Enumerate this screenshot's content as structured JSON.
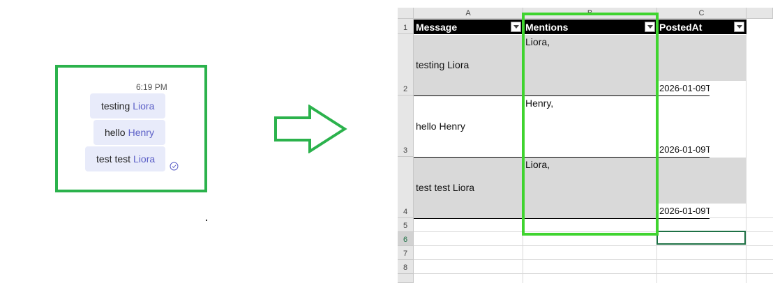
{
  "chat": {
    "time": "6:19 PM",
    "messages": [
      {
        "text": "testing",
        "mention": "Liora"
      },
      {
        "text": "hello",
        "mention": "Henry"
      },
      {
        "text": "test test",
        "mention": "Liora"
      }
    ]
  },
  "sheet": {
    "columns": [
      "A",
      "B",
      "C"
    ],
    "row_numbers": [
      "1",
      "2",
      "3",
      "4",
      "5",
      "6",
      "7",
      "8"
    ],
    "headers": [
      "Message",
      "Mentions",
      "PostedAt"
    ],
    "rows": [
      {
        "message": "testing Liora",
        "mentions": "Liora,",
        "posted_at": "2026-01-09T"
      },
      {
        "message": "hello Henry",
        "mentions": "Henry,",
        "posted_at": "2026-01-09T"
      },
      {
        "message": "test test Liora",
        "mentions": "Liora,",
        "posted_at": "2026-01-09T"
      }
    ]
  },
  "colors": {
    "highlight_green": "#2bb24c",
    "mention_purple": "#5b5fc7",
    "bubble_bg": "#e8ebfa",
    "excel_green": "#1e7145"
  },
  "icons": [
    "read-receipt-icon",
    "right-arrow-icon",
    "filter-dropdown-icon"
  ]
}
